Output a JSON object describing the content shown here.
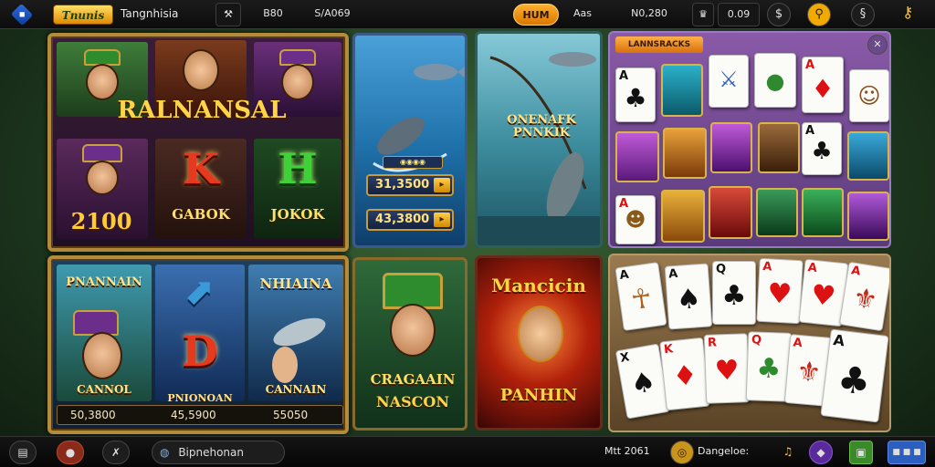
{
  "topbar": {
    "menu_icon": "diamond-menu-icon",
    "logo_text": "Tnunis",
    "app_name": "Tangnhisia",
    "tool_icon": "crossed-tools-icon",
    "stat_1": "B80",
    "stat_2": "S/A069",
    "button_label": "HUM",
    "field_label": "Aas",
    "balance": "N0,280",
    "balance_icon": "crown-icon",
    "counter": "0.09",
    "icons": [
      "cash-icon",
      "search-icon",
      "dollar-icon",
      "key-icon"
    ]
  },
  "game_tiles": {
    "slot_main": {
      "title": "RALNANSAL",
      "amount": "2100",
      "letter_k": "K",
      "letter_h": "H",
      "label_k": "GABOK",
      "label_h": "JOKOK"
    },
    "fishing": {
      "amounts": [
        "31,3500",
        "43,3800"
      ],
      "chip_label": "◉◉◉◉"
    },
    "fishing_2": {
      "title": "ONENAFK\nPNNKIK"
    },
    "card_grid": {
      "header": "LANNSRACKS",
      "card_ranks": [
        "A",
        "A",
        "A",
        "A"
      ]
    },
    "slot_second": {
      "title": "PNANNAIN",
      "header_2": "NHIAINA",
      "letter_d": "D",
      "labels": [
        "CANNOL",
        "PNIONOAN",
        "CANNAIN"
      ],
      "values": [
        "50,3800",
        "45,5900",
        "55050"
      ]
    },
    "leprechaun": {
      "title_1": "CRAGAAIN",
      "title_2": "NASCON"
    },
    "hero": {
      "title": "Mancicin",
      "banner": "PANHIN"
    },
    "cards_spread": {
      "ranks": [
        "A",
        "A",
        "Q",
        "A",
        "A",
        "A",
        "X",
        "K",
        "R",
        "Q",
        "A",
        "A"
      ]
    }
  },
  "bottombar": {
    "left_icons": [
      "book-icon",
      "coins-icon",
      "x-icon"
    ],
    "search_icon": "globe-icon",
    "search_text": "Bipnehonan",
    "meta_text": "Mtt 2061",
    "coin_label": "Dangeloe:",
    "right_icons": [
      "bell-icon",
      "gem-icon",
      "gift-icon"
    ],
    "action_label": "■ ■ ■"
  },
  "colors": {
    "gold": "#ffd447",
    "frame": "#b48a3b",
    "accent_blue": "#2d6be0"
  }
}
